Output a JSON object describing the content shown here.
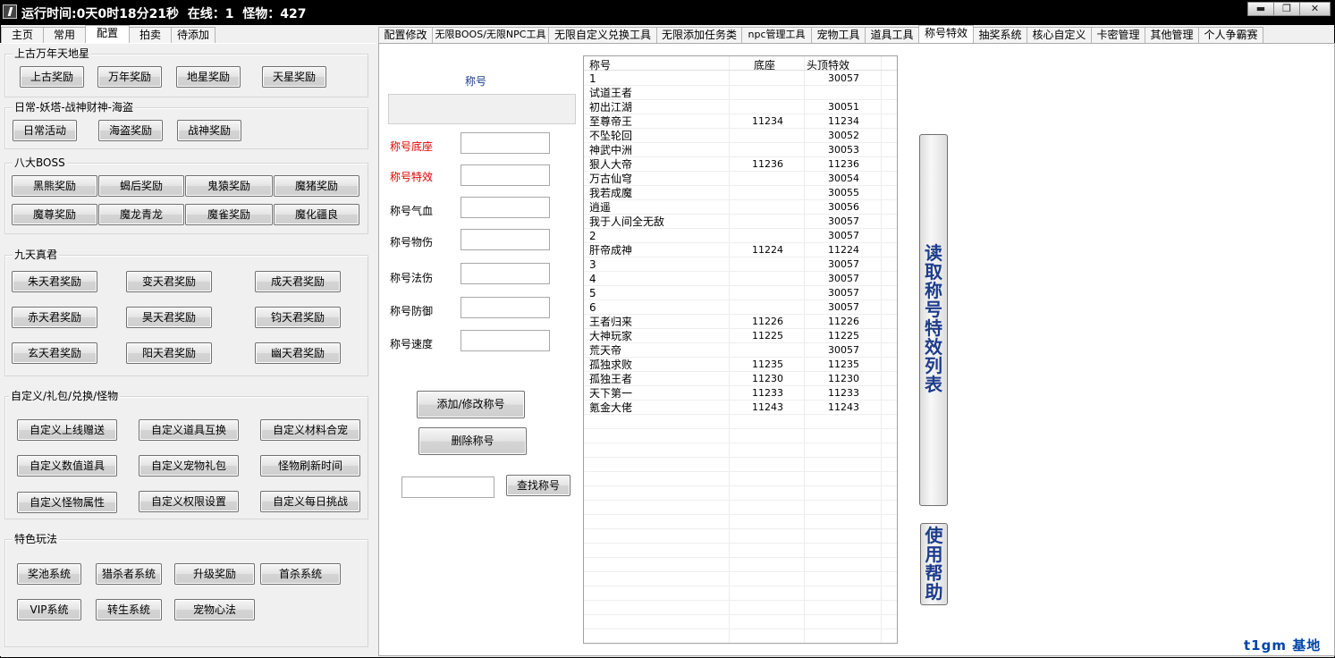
{
  "titlebar": {
    "runtime_label": "运行时间:0天0时18分21秒",
    "online_label": "在线：1",
    "monster_label": "怪物：427",
    "min": "▬",
    "max": "❐",
    "close": "✕"
  },
  "left_tabs": [
    "主页",
    "常用",
    "配置",
    "拍卖",
    "待添加"
  ],
  "right_tabs": [
    "配置修改",
    "无限BOOS/无限NPC工具",
    "无限自定义兑换工具",
    "无限添加任务类",
    "npc管理工具",
    "宠物工具",
    "道具工具",
    "称号特效",
    "抽奖系统",
    "核心自定义",
    "卡密管理",
    "其他管理",
    "个人争霸赛"
  ],
  "groups": {
    "g1": {
      "title": "上古万年天地星",
      "buttons": [
        "上古奖励",
        "万年奖励",
        "地星奖励",
        "天星奖励"
      ]
    },
    "g2": {
      "title": "日常-妖塔-战神财神-海盗",
      "buttons": [
        "日常活动",
        "海盗奖励",
        "战神奖励"
      ]
    },
    "g3": {
      "title": "八大BOSS",
      "buttons": [
        "黑熊奖励",
        "蝎后奖励",
        "鬼猿奖励",
        "魔猪奖励",
        "魔尊奖励",
        "魔龙青龙",
        "魔雀奖励",
        "魔化疆良"
      ]
    },
    "g4": {
      "title": "九天真君",
      "buttons": [
        "朱天君奖励",
        "变天君奖励",
        "成天君奖励",
        "赤天君奖励",
        "昊天君奖励",
        "钧天君奖励",
        "玄天君奖励",
        "阳天君奖励",
        "幽天君奖励"
      ]
    },
    "g5": {
      "title": "自定义/礼包/兑换/怪物",
      "buttons": [
        "自定义上线赠送",
        "自定义道具互换",
        "自定义材料合宠",
        "自定义数值道具",
        "自定义宠物礼包",
        "怪物刷新时间",
        "自定义怪物属性",
        "自定义权限设置",
        "自定义每日挑战"
      ]
    },
    "g6": {
      "title": "特色玩法",
      "buttons": [
        "奖池系统",
        "猎杀者系统",
        "升级奖励",
        "首杀系统",
        "VIP系统",
        "转生系统",
        "宠物心法"
      ]
    }
  },
  "form": {
    "header": "称号",
    "fields": [
      "称号底座",
      "称号特效",
      "称号气血",
      "称号物伤",
      "称号法伤",
      "称号防御",
      "称号速度"
    ],
    "add_button": "添加/修改称号",
    "delete_button": "删除称号",
    "search_button": "查找称号"
  },
  "table": {
    "columns": [
      "称号",
      "底座",
      "头顶特效"
    ],
    "rows": [
      [
        "1",
        "",
        "30057"
      ],
      [
        "试道王者",
        "",
        ""
      ],
      [
        "初出江湖",
        "",
        "30051"
      ],
      [
        "至尊帝王",
        "11234",
        "11234"
      ],
      [
        "不坠轮回",
        "",
        "30052"
      ],
      [
        "神武中洲",
        "",
        "30053"
      ],
      [
        "狠人大帝",
        "11236",
        "11236"
      ],
      [
        "万古仙穹",
        "",
        "30054"
      ],
      [
        "我若成魔",
        "",
        "30055"
      ],
      [
        "逍遥",
        "",
        "30056"
      ],
      [
        "我于人间全无敌",
        "",
        "30057"
      ],
      [
        "2",
        "",
        "30057"
      ],
      [
        "肝帝成神",
        "11224",
        "11224"
      ],
      [
        "3",
        "",
        "30057"
      ],
      [
        "4",
        "",
        "30057"
      ],
      [
        "5",
        "",
        "30057"
      ],
      [
        "6",
        "",
        "30057"
      ],
      [
        "王者归来",
        "11226",
        "11226"
      ],
      [
        "大神玩家",
        "11225",
        "11225"
      ],
      [
        "荒天帝",
        "",
        "30057"
      ],
      [
        "孤独求败",
        "11235",
        "11235"
      ],
      [
        "孤独王者",
        "11230",
        "11230"
      ],
      [
        "天下第一",
        "11233",
        "11233"
      ],
      [
        "氪金大佬",
        "11243",
        "11243"
      ]
    ],
    "empty_rows": 16
  },
  "side_buttons": {
    "read": "读取称号特效列表",
    "help": "使用帮助"
  },
  "brand": "t1gm 基地"
}
